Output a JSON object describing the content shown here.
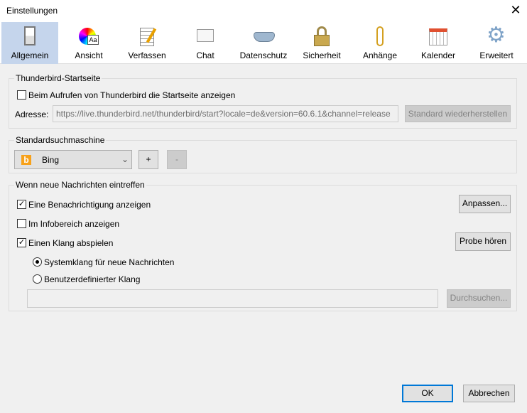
{
  "window": {
    "title": "Einstellungen",
    "close": "✕"
  },
  "tabs": [
    {
      "label": "Allgemein",
      "icon": "switch-icon",
      "selected": true
    },
    {
      "label": "Ansicht",
      "icon": "color-wheel-icon"
    },
    {
      "label": "Verfassen",
      "icon": "compose-icon"
    },
    {
      "label": "Chat",
      "icon": "chat-bubble-icon"
    },
    {
      "label": "Datenschutz",
      "icon": "mask-icon"
    },
    {
      "label": "Sicherheit",
      "icon": "padlock-icon"
    },
    {
      "label": "Anhänge",
      "icon": "paperclip-icon"
    },
    {
      "label": "Kalender",
      "icon": "calendar-icon"
    },
    {
      "label": "Erweitert",
      "icon": "gear-icon"
    }
  ],
  "startpage": {
    "legend": "Thunderbird-Startseite",
    "show_label": "Beim Aufrufen von Thunderbird die Startseite anzeigen",
    "address_label": "Adresse:",
    "address_value": "https://live.thunderbird.net/thunderbird/start?locale=de&version=60.6.1&channel=release",
    "restore_button": "Standard wiederherstellen"
  },
  "search": {
    "legend": "Standardsuchmaschine",
    "selected": "Bing",
    "add": "+",
    "remove": "-"
  },
  "newmail": {
    "legend": "Wenn neue Nachrichten eintreffen",
    "notify_label": "Eine Benachrichtigung anzeigen",
    "notify_checked": true,
    "customize_button": "Anpassen...",
    "tray_label": "Im Infobereich anzeigen",
    "tray_checked": false,
    "sound_label": "Einen Klang abspielen",
    "sound_checked": true,
    "preview_button": "Probe hören",
    "system_sound": "Systemklang für neue Nachrichten",
    "custom_sound": "Benutzerdefinierter Klang",
    "sound_file": "",
    "browse_button": "Durchsuchen..."
  },
  "footer": {
    "ok": "OK",
    "cancel": "Abbrechen"
  }
}
